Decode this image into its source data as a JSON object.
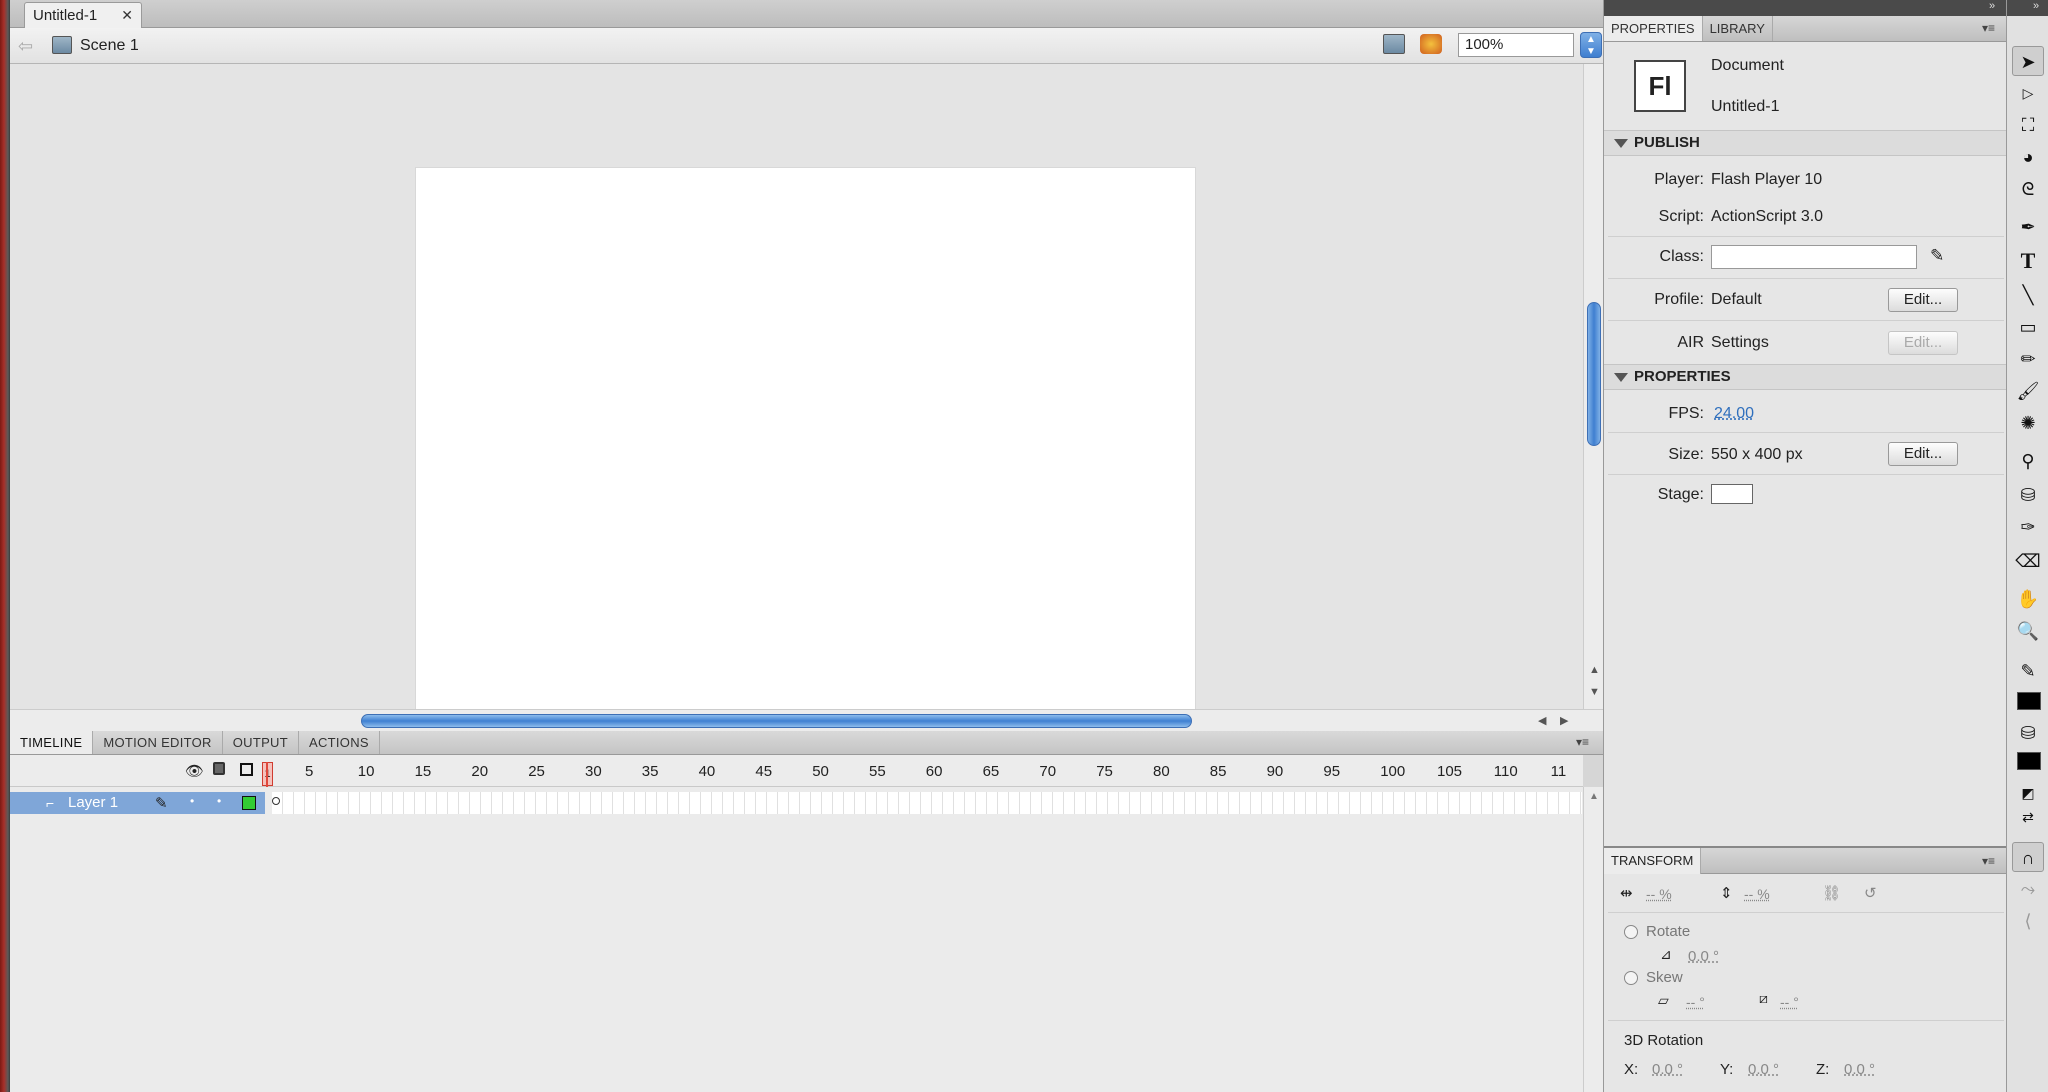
{
  "document": {
    "tab_title": "Untitled-1",
    "close_glyph": "✕"
  },
  "editbar": {
    "scene_label": "Scene 1",
    "zoom_value": "100%"
  },
  "timeline": {
    "tabs": [
      "TIMELINE",
      "MOTION EDITOR",
      "OUTPUT",
      "ACTIONS"
    ],
    "frame_numbers": [
      "5",
      "10",
      "15",
      "20",
      "25",
      "30",
      "35",
      "40",
      "45",
      "50",
      "55",
      "60",
      "65",
      "70",
      "75",
      "80",
      "85",
      "90",
      "95",
      "100",
      "105",
      "110",
      "11"
    ],
    "current_frame": "1",
    "layer_name": "Layer 1"
  },
  "properties": {
    "tabs": [
      "PROPERTIES",
      "LIBRARY"
    ],
    "doc_icon_text": "Fl",
    "doc_type": "Document",
    "doc_name": "Untitled-1",
    "publish_header": "PUBLISH",
    "player_label": "Player:",
    "player_value": "Flash Player 10",
    "script_label": "Script:",
    "script_value": "ActionScript 3.0",
    "class_label": "Class:",
    "class_value": "",
    "profile_label": "Profile:",
    "profile_value": "Default",
    "edit_label": "Edit...",
    "air_label": "AIR",
    "air_value": "Settings",
    "properties_header": "PROPERTIES",
    "fps_label": "FPS:",
    "fps_value": "24.00",
    "size_label": "Size:",
    "size_value": "550 x 400 px",
    "stage_label": "Stage:",
    "stage_color": "#ffffff"
  },
  "transform": {
    "header": "TRANSFORM",
    "width_pct": "-- %",
    "height_pct": "-- %",
    "rotate_label": "Rotate",
    "rotate_value": "0.0 °",
    "skew_label": "Skew",
    "skew_h": "-- °",
    "skew_v": "-- °",
    "rotation3d_label": "3D Rotation",
    "x_label": "X:",
    "x_value": "0.0 °",
    "y_label": "Y:",
    "y_value": "0.0 °",
    "z_label": "Z:",
    "z_value": "0.0 °"
  },
  "colors": {
    "accent_blue": "#3f7fd0",
    "playhead_red": "#e0483c",
    "layer_green": "#33cc33"
  }
}
